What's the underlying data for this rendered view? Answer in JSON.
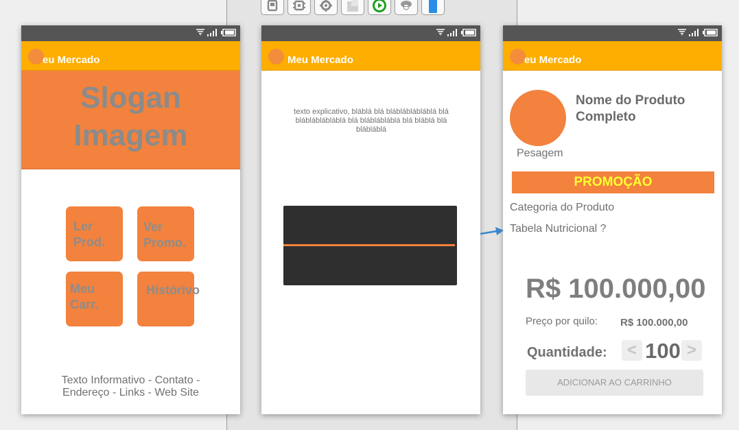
{
  "toolbar": {
    "tools": [
      {
        "icon": "component-icon"
      },
      {
        "icon": "chip-icon"
      },
      {
        "icon": "gear-icon"
      },
      {
        "icon": "page-icon"
      },
      {
        "icon": "play-icon"
      },
      {
        "icon": "sheep-icon"
      },
      {
        "icon": "phone-device-icon"
      }
    ]
  },
  "colors": {
    "appbar": "#fdae00",
    "accent_orange": "#f2823d",
    "status_bar": "#555555",
    "promo_text": "#ffff33"
  },
  "screen_home": {
    "app_title": "eu Mercado",
    "hero_lines": [
      "Slogan",
      "Imagem"
    ],
    "tiles": [
      {
        "label": "Ler\nProd."
      },
      {
        "label": "Ver\nPromo."
      },
      {
        "label": "Meu\nCarr."
      },
      {
        "label": "Histórivo"
      }
    ],
    "footer_lines": [
      "Texto Informativo - Contato -",
      "Endereço - Links - Web Site"
    ]
  },
  "screen_scan": {
    "app_title": "Meu Mercado",
    "explain_text": "texto explicativo, bláblá blá blábláblábláblá blá blábláblábláblá blá bláblábláblá blá bláblá blá blábláblá"
  },
  "screen_product": {
    "app_title": "eu Mercado",
    "product_name": "Nome do Produto Completo",
    "weighing_label": "Pesagem",
    "promo_label": "PROMOÇÃO",
    "category_link": "Categoria do Produto",
    "nutrition_link": "Tabela Nutricional ?",
    "price": "R$ 100.000,00",
    "price_per_kilo_label": "Preço por quilo:",
    "price_per_kilo_value": "R$ 100.000,00",
    "quantity_label": "Quantidade:",
    "quantity_value": "100",
    "decrement_symbol": "<",
    "increment_symbol": ">",
    "add_to_cart_label": "ADICIONAR AO CARRINHO"
  }
}
